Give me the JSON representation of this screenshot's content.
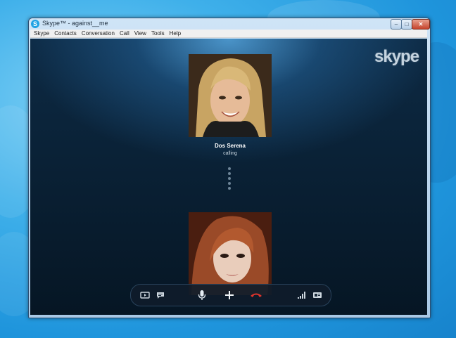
{
  "window": {
    "title": "Skype™ - against__me",
    "app_icon_letter": "S",
    "min_glyph": "–",
    "max_glyph": "□",
    "close_glyph": "✕"
  },
  "menu": [
    "Skype",
    "Contacts",
    "Conversation",
    "Call",
    "View",
    "Tools",
    "Help"
  ],
  "call": {
    "logo": "skype",
    "contact_name": "Dos Serena",
    "status": "calling"
  },
  "controls": {
    "items": [
      {
        "name": "video-icon"
      },
      {
        "name": "chat-icon"
      },
      {
        "name": "microphone-icon"
      },
      {
        "name": "add-icon"
      },
      {
        "name": "end-call-icon",
        "color": "#e0342c"
      },
      {
        "name": "signal-strength-icon"
      },
      {
        "name": "device-settings-icon"
      }
    ]
  }
}
